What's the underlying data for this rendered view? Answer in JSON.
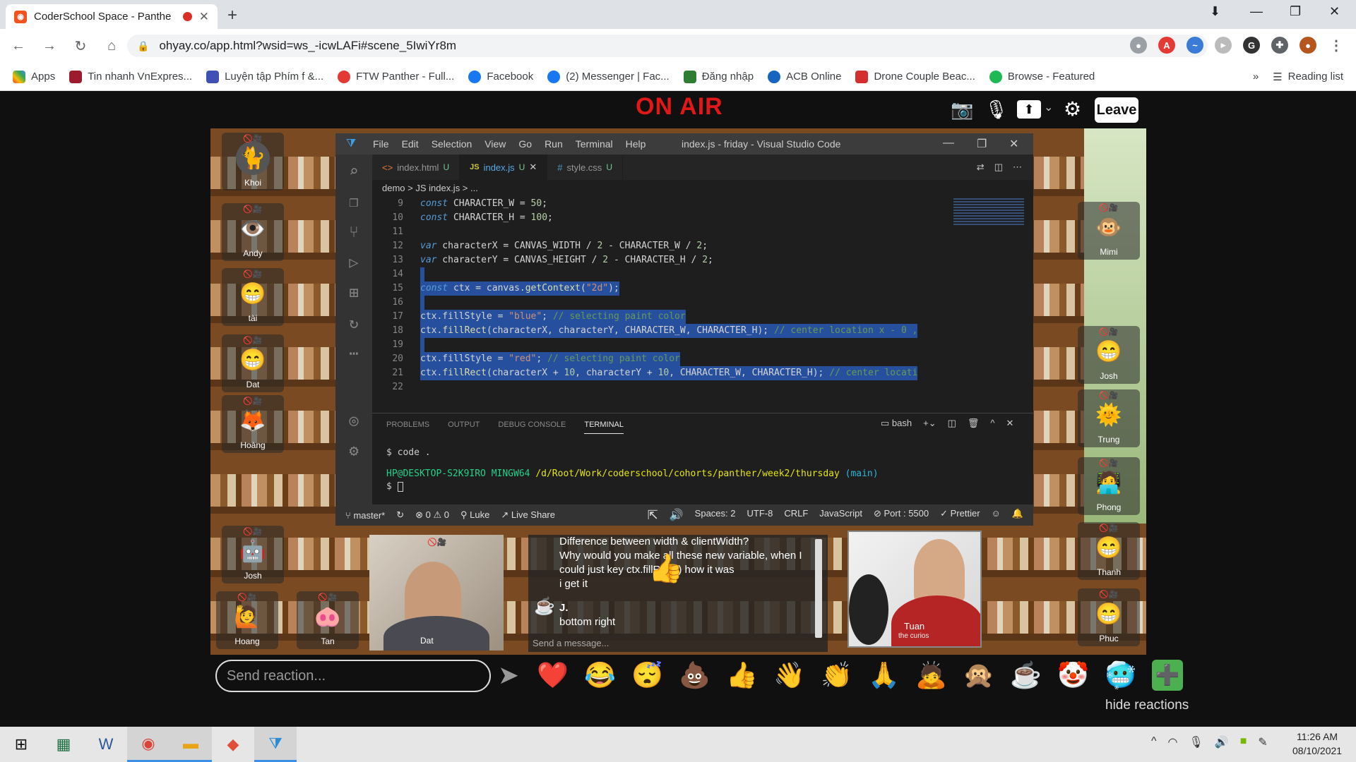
{
  "browser": {
    "tab_title": "CoderSchool Space - Panthe",
    "url": "ohyay.co/app.html?wsid=ws_-icwLAFi#scene_5IwiYr8m",
    "bookmarks": [
      "Apps",
      "Tin nhanh VnExpres...",
      "Luyện tập Phím f &...",
      "FTW Panther - Full...",
      "Facebook",
      "(2) Messenger | Fac...",
      "Đăng nhập",
      "ACB Online",
      "Drone Couple Beac...",
      "Browse - Featured"
    ],
    "reading_list": "Reading list",
    "more": "»"
  },
  "app": {
    "on_air": "ON AIR",
    "leave_label": "Leave",
    "send_reaction_placeholder": "Send reaction...",
    "hide_reactions": "hide reactions",
    "reactions": [
      "❤️",
      "😂",
      "😴",
      "💩",
      "👍",
      "👋",
      "👏",
      "🙏",
      "🙇",
      "🙊",
      "☕",
      "🤡",
      "🥶",
      "➕"
    ]
  },
  "participants": {
    "left": [
      {
        "name": "Khoi",
        "icon": "🐈"
      },
      {
        "name": "Andy",
        "icon": "👁️"
      },
      {
        "name": "tài",
        "icon": "😁"
      },
      {
        "name": "Dat",
        "icon": "😁"
      },
      {
        "name": "Hoàng",
        "icon": "🦊"
      },
      {
        "name": "Josh",
        "icon": "🤖"
      },
      {
        "name": "Hoang",
        "icon": "🙋"
      },
      {
        "name": "Tan",
        "icon": "🐽"
      }
    ],
    "right": [
      {
        "name": "Mimi",
        "icon": "🐵"
      },
      {
        "name": "Josh",
        "icon": "😁"
      },
      {
        "name": "Trung",
        "icon": "🌞"
      },
      {
        "name": "Phong",
        "icon": "🧑‍💻"
      },
      {
        "name": "Thanh",
        "icon": "😁"
      },
      {
        "name": "Phuc",
        "icon": "😁"
      }
    ],
    "cam_left": "Dat",
    "cam_right": "Tuan",
    "cam_right_sub": "the curios"
  },
  "chat": {
    "messages": [
      {
        "author": "",
        "text": "Difference between width & clientWidth?"
      },
      {
        "author": "",
        "text": "Why would you make all these new variable, when I could just key ctx.fillRect() how it was"
      },
      {
        "author": "",
        "text": "i get it"
      },
      {
        "author": "J.",
        "text": "bottom right"
      }
    ],
    "placeholder": "Send a message..."
  },
  "vscode": {
    "menu": [
      "File",
      "Edit",
      "Selection",
      "View",
      "Go",
      "Run",
      "Terminal",
      "Help"
    ],
    "title": "index.js - friday - Visual Studio Code",
    "tabs": [
      {
        "label": "index.html",
        "badge": "U",
        "icon": "<>"
      },
      {
        "label": "index.js",
        "badge": "U",
        "icon": "JS"
      },
      {
        "label": "style.css",
        "badge": "U",
        "icon": "#"
      }
    ],
    "breadcrumb": "demo > JS index.js > ...",
    "line_numbers": [
      "9",
      "10",
      "11",
      "12",
      "13",
      "14",
      "15",
      "16",
      "17",
      "18",
      "19",
      "20",
      "21",
      "22"
    ],
    "panel_tabs": [
      "PROBLEMS",
      "OUTPUT",
      "DEBUG CONSOLE",
      "TERMINAL"
    ],
    "terminal_shell": "bash",
    "terminal_cmd": "$ code .",
    "terminal_prompt_user": "HP@DESKTOP-S2K9IRO MINGW64",
    "terminal_prompt_path": "/d/Root/Work/coderschool/cohorts/panther/week2/thursday",
    "terminal_branch": "(main)",
    "terminal_input": "$",
    "status": {
      "branch": "master*",
      "errors": "⊗ 0 ⚠ 0",
      "user": "Luke",
      "live_share": "Live Share",
      "spaces": "Spaces: 2",
      "encoding": "UTF-8",
      "eol": "CRLF",
      "lang": "JavaScript",
      "port": "Port : 5500",
      "prettier": "✓ Prettier"
    }
  },
  "taskbar": {
    "time": "11:26 AM",
    "date": "08/10/2021"
  }
}
